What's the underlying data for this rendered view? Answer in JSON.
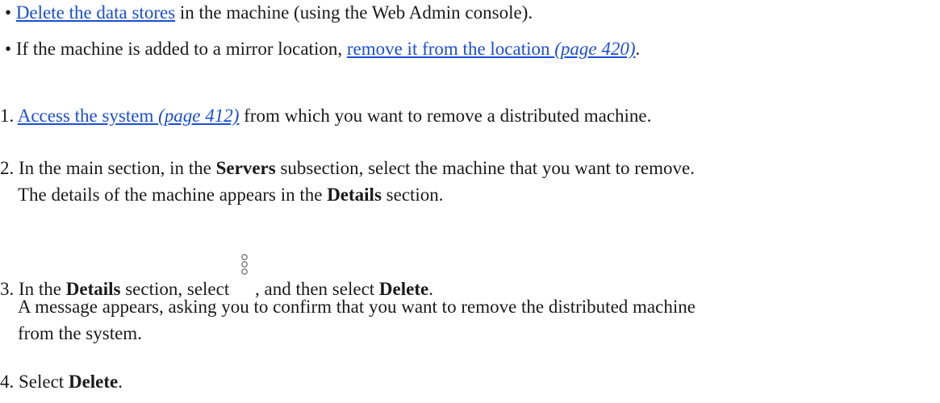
{
  "prereq": {
    "bullet": "•",
    "item1": {
      "link": "Delete the data stores",
      "text": " in the machine (using the Web Admin console)."
    },
    "item2": {
      "text": "If the machine is added to a mirror location, ",
      "link": "remove it from the location",
      "page_ref": "(page 420)",
      "end": "."
    }
  },
  "steps": {
    "step1": {
      "num": "1.",
      "link": "Access the system",
      "page_ref": "(page 412)",
      "text": " from which you want to remove a distributed machine."
    },
    "step2": {
      "num": "2.",
      "text_a": "In the main section, in the ",
      "bold_a": "Servers",
      "text_b": " subsection, select the machine that you want to remove.",
      "line2_a": "The details of the machine appears in the ",
      "bold_b": "Details",
      "line2_b": " section."
    },
    "step3": {
      "num": "3.",
      "text_a": "In the ",
      "bold_a": "Details",
      "text_b": " section, select ",
      "icon": "more-options-icon",
      "text_c": ", and then select ",
      "bold_b": "Delete",
      "text_d": ".",
      "line2": "A message appears, asking you to confirm that you want to remove the distributed machine",
      "line3": "from the system."
    },
    "step4": {
      "num": "4.",
      "text_a": "Select ",
      "bold_a": "Delete",
      "text_b": "."
    }
  },
  "colors": {
    "link": "#1a4ed8",
    "text": "#1a1a1a"
  }
}
